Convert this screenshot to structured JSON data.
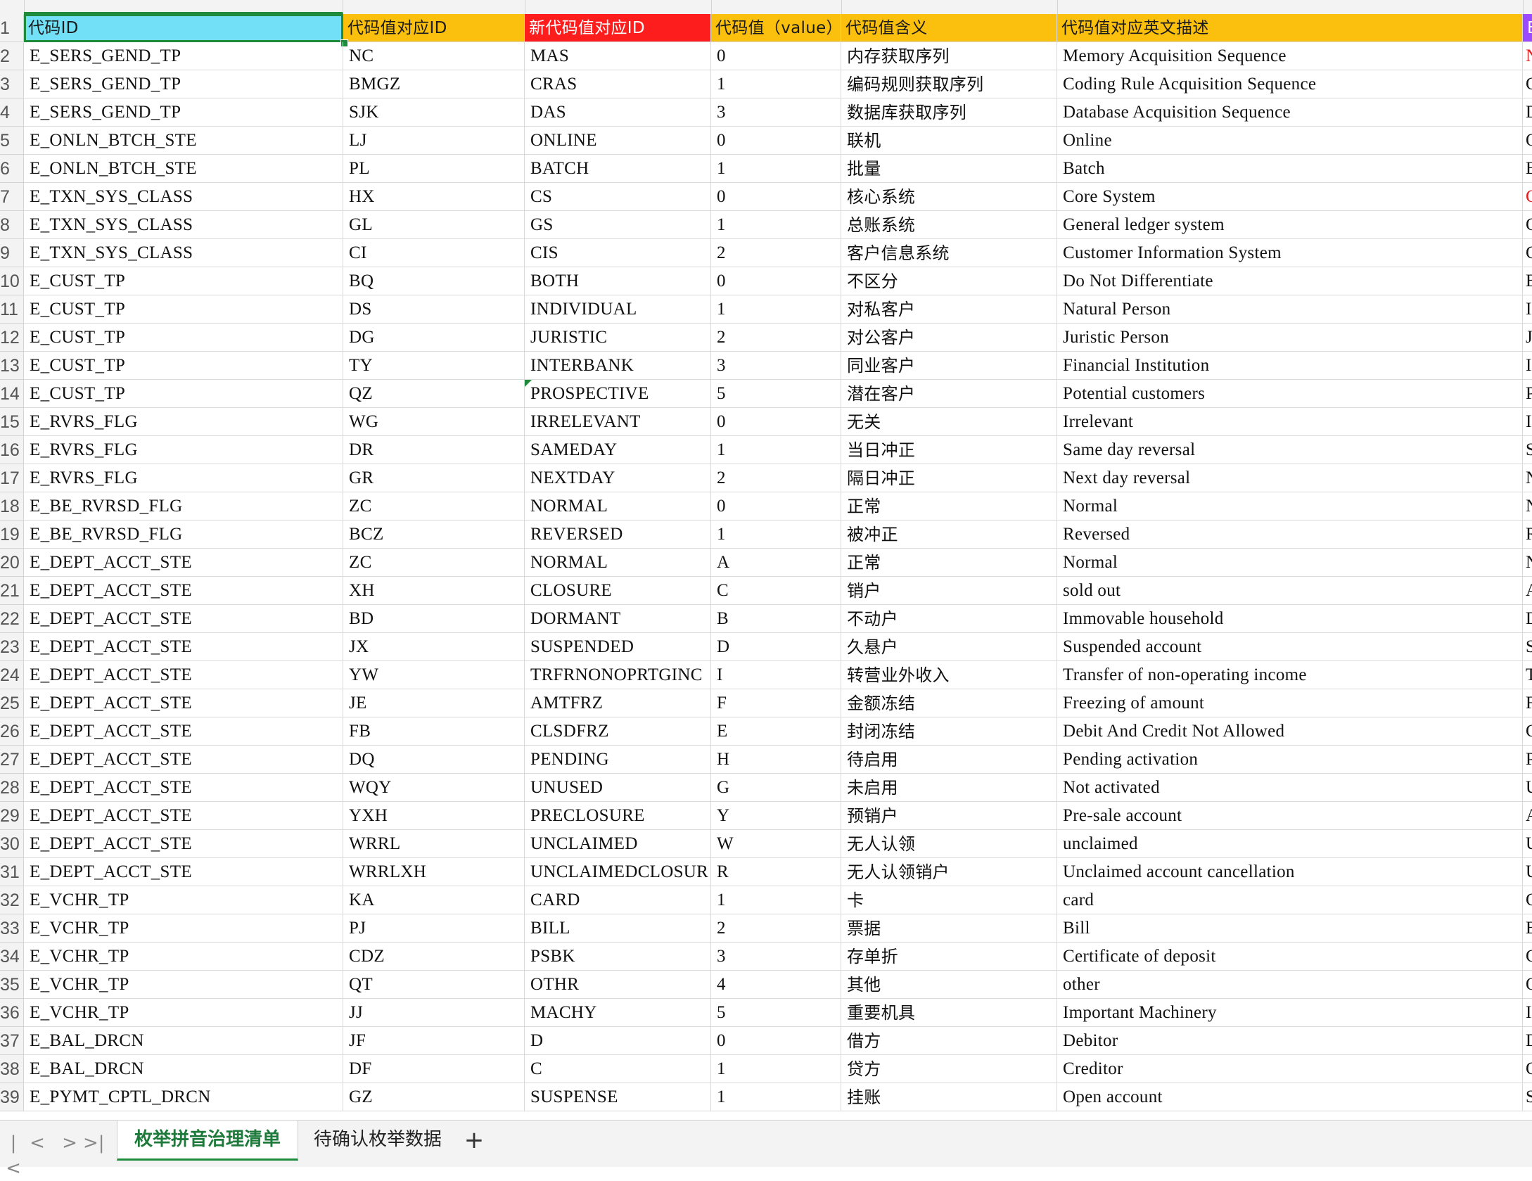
{
  "sheet": {
    "name": "spreadsheet",
    "header_colors": {
      "A": "#72e1f8",
      "B": "#fbc00e",
      "C": "#fd1d1d",
      "D": "#fbc00e",
      "E": "#fbc00e",
      "F": "#fbc00e",
      "G": "#9b4bff"
    },
    "red_text_color": "#e31b1b",
    "header": {
      "num": "1",
      "a": "代码ID",
      "b": "代码值对应ID",
      "c": "新代码值对应ID",
      "d": "代码值（value）",
      "e": "代码值含义",
      "f": "代码值对应英文描述",
      "g": "B"
    },
    "rows": [
      {
        "num": "2",
        "a": "E_SERS_GEND_TP",
        "b": "NC",
        "c": "MAS",
        "d": "0",
        "e": "内存获取序列",
        "f": "Memory Acquisition Sequence",
        "g": "N"
      },
      {
        "num": "3",
        "a": "E_SERS_GEND_TP",
        "b": "BMGZ",
        "c": "CRAS",
        "d": "1",
        "e": "编码规则获取序列",
        "f": "Coding Rule Acquisition Sequence",
        "g": "C"
      },
      {
        "num": "4",
        "a": "E_SERS_GEND_TP",
        "b": "SJK",
        "c": "DAS",
        "d": "3",
        "e": "数据库获取序列",
        "f": "Database Acquisition Sequence",
        "g": "D"
      },
      {
        "num": "5",
        "a": "E_ONLN_BTCH_STE",
        "b": "LJ",
        "c": "ONLINE",
        "d": "0",
        "e": "联机",
        "f": "Online",
        "g": "O"
      },
      {
        "num": "6",
        "a": "E_ONLN_BTCH_STE",
        "b": "PL",
        "c": "BATCH",
        "d": "1",
        "e": "批量",
        "f": "Batch",
        "g": "B"
      },
      {
        "num": "7",
        "a": "E_TXN_SYS_CLASS",
        "b": "HX",
        "c": "CS",
        "d": "0",
        "e": "核心系统",
        "f": "Core System",
        "g": "C"
      },
      {
        "num": "8",
        "a": "E_TXN_SYS_CLASS",
        "b": "GL",
        "c": "GS",
        "d": "1",
        "e": "总账系统",
        "f": "General ledger system",
        "g": "G"
      },
      {
        "num": "9",
        "a": "E_TXN_SYS_CLASS",
        "b": "CI",
        "c": "CIS",
        "d": "2",
        "e": "客户信息系统",
        "f": "Customer Information System",
        "g": "C"
      },
      {
        "num": "10",
        "a": "E_CUST_TP",
        "b": "BQ",
        "c": "BOTH",
        "d": "0",
        "e": "不区分",
        "f": "Do Not Differentiate",
        "g": "B"
      },
      {
        "num": "11",
        "a": "E_CUST_TP",
        "b": "DS",
        "c": "INDIVIDUAL",
        "d": "1",
        "e": "对私客户",
        "f": "Natural Person",
        "g": "I"
      },
      {
        "num": "12",
        "a": "E_CUST_TP",
        "b": "DG",
        "c": "JURISTIC",
        "d": "2",
        "e": "对公客户",
        "f": "Juristic Person",
        "g": "J"
      },
      {
        "num": "13",
        "a": "E_CUST_TP",
        "b": "TY",
        "c": "INTERBANK",
        "d": "3",
        "e": "同业客户",
        "f": "Financial Institution",
        "g": "I"
      },
      {
        "num": "14",
        "a": "E_CUST_TP",
        "b": "QZ",
        "c": "PROSPECTIVE",
        "d": "5",
        "e": "潜在客户",
        "f": "Potential customers",
        "g": "P"
      },
      {
        "num": "15",
        "a": "E_RVRS_FLG",
        "b": "WG",
        "c": "IRRELEVANT",
        "d": "0",
        "e": "无关",
        "f": "Irrelevant",
        "g": "I"
      },
      {
        "num": "16",
        "a": "E_RVRS_FLG",
        "b": "DR",
        "c": "SAMEDAY",
        "d": "1",
        "e": "当日冲正",
        "f": "Same day reversal",
        "g": "S"
      },
      {
        "num": "17",
        "a": "E_RVRS_FLG",
        "b": "GR",
        "c": "NEXTDAY",
        "d": "2",
        "e": "隔日冲正",
        "f": "Next day reversal",
        "g": "N"
      },
      {
        "num": "18",
        "a": "E_BE_RVRSD_FLG",
        "b": "ZC",
        "c": "NORMAL",
        "d": "0",
        "e": "正常",
        "f": "Normal",
        "g": "N"
      },
      {
        "num": "19",
        "a": "E_BE_RVRSD_FLG",
        "b": "BCZ",
        "c": "REVERSED",
        "d": "1",
        "e": "被冲正",
        "f": "Reversed",
        "g": "R"
      },
      {
        "num": "20",
        "a": "E_DEPT_ACCT_STE",
        "b": "ZC",
        "c": "NORMAL",
        "d": "A",
        "e": "正常",
        "f": "Normal",
        "g": "N"
      },
      {
        "num": "21",
        "a": "E_DEPT_ACCT_STE",
        "b": "XH",
        "c": "CLOSURE",
        "d": "C",
        "e": "销户",
        "f": "sold out",
        "g": "A"
      },
      {
        "num": "22",
        "a": "E_DEPT_ACCT_STE",
        "b": "BD",
        "c": "DORMANT",
        "d": "B",
        "e": "不动户",
        "f": "Immovable household",
        "g": "D"
      },
      {
        "num": "23",
        "a": "E_DEPT_ACCT_STE",
        "b": "JX",
        "c": "SUSPENDED",
        "d": "D",
        "e": "久悬户",
        "f": "Suspended account",
        "g": "S"
      },
      {
        "num": "24",
        "a": "E_DEPT_ACCT_STE",
        "b": "YW",
        "c": "TRFRNONOPRTGINC",
        "d": "I",
        "e": "转营业外收入",
        "f": "Transfer of non-operating income",
        "g": "T"
      },
      {
        "num": "25",
        "a": "E_DEPT_ACCT_STE",
        "b": "JE",
        "c": "AMTFRZ",
        "d": "F",
        "e": "金额冻结",
        "f": "Freezing of amount",
        "g": "F"
      },
      {
        "num": "26",
        "a": "E_DEPT_ACCT_STE",
        "b": "FB",
        "c": "CLSDFRZ",
        "d": "E",
        "e": "封闭冻结",
        "f": "Debit And Credit Not Allowed",
        "g": "C"
      },
      {
        "num": "27",
        "a": "E_DEPT_ACCT_STE",
        "b": "DQ",
        "c": "PENDING",
        "d": "H",
        "e": "待启用",
        "f": "Pending activation",
        "g": "P"
      },
      {
        "num": "28",
        "a": "E_DEPT_ACCT_STE",
        "b": "WQY",
        "c": "UNUSED",
        "d": "G",
        "e": "未启用",
        "f": "Not activated",
        "g": "U"
      },
      {
        "num": "29",
        "a": "E_DEPT_ACCT_STE",
        "b": "YXH",
        "c": "PRECLOSURE",
        "d": "Y",
        "e": "预销户",
        "f": "Pre-sale account",
        "g": "A"
      },
      {
        "num": "30",
        "a": "E_DEPT_ACCT_STE",
        "b": "WRRL",
        "c": "UNCLAIMED",
        "d": "W",
        "e": "无人认领",
        "f": "unclaimed",
        "g": "U"
      },
      {
        "num": "31",
        "a": "E_DEPT_ACCT_STE",
        "b": "WRRLXH",
        "c": "UNCLAIMEDCLOSUR",
        "d": "R",
        "e": "无人认领销户",
        "f": "Unclaimed account cancellation",
        "g": "U"
      },
      {
        "num": "32",
        "a": "E_VCHR_TP",
        "b": "KA",
        "c": "CARD",
        "d": "1",
        "e": "卡",
        "f": "card",
        "g": "C"
      },
      {
        "num": "33",
        "a": "E_VCHR_TP",
        "b": "PJ",
        "c": "BILL",
        "d": "2",
        "e": "票据",
        "f": "Bill",
        "g": "B"
      },
      {
        "num": "34",
        "a": "E_VCHR_TP",
        "b": "CDZ",
        "c": "PSBK",
        "d": "3",
        "e": "存单折",
        "f": "Certificate of deposit",
        "g": "C"
      },
      {
        "num": "35",
        "a": "E_VCHR_TP",
        "b": "QT",
        "c": "OTHR",
        "d": "4",
        "e": "其他",
        "f": "other",
        "g": "O"
      },
      {
        "num": "36",
        "a": "E_VCHR_TP",
        "b": "JJ",
        "c": "MACHY",
        "d": "5",
        "e": "重要机具",
        "f": "Important Machinery",
        "g": "I"
      },
      {
        "num": "37",
        "a": "E_BAL_DRCN",
        "b": "JF",
        "c": "D",
        "d": "0",
        "e": "借方",
        "f": "Debitor",
        "g": "D"
      },
      {
        "num": "38",
        "a": "E_BAL_DRCN",
        "b": "DF",
        "c": "C",
        "d": "1",
        "e": "贷方",
        "f": "Creditor",
        "g": "C"
      },
      {
        "num": "39",
        "a": "E_PYMT_CPTL_DRCN",
        "b": "GZ",
        "c": "SUSPENSE",
        "d": "1",
        "e": "挂账",
        "f": "Open account",
        "g": "S"
      }
    ]
  },
  "tabs": {
    "nav": {
      "first": "|<",
      "prev": "<",
      "next": ">",
      "last": ">|"
    },
    "items": [
      {
        "label": "枚举拼音治理清单",
        "active": true
      },
      {
        "label": "待确认枚举数据",
        "active": false
      }
    ],
    "add_label": "+"
  }
}
